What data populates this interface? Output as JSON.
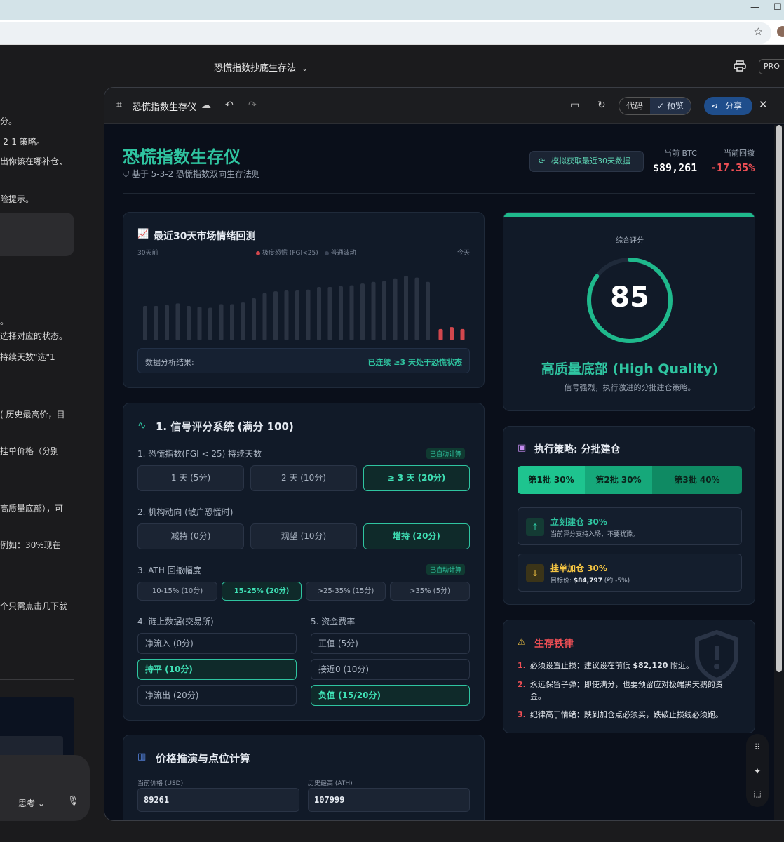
{
  "browser": {
    "minimize": "—",
    "maximize": "☐",
    "bookmark_icon": "star-icon"
  },
  "app": {
    "doc_title": "恐慌指数抄底生存法",
    "pro": "PRO"
  },
  "chat": {
    "lines": [
      "分。",
      "-2-1 策略。",
      "出你该在哪补仓、",
      "险提示。",
      "。",
      "选择对应的状态。",
      "持续天数\"选\"1",
      "( 历史最高价，目",
      "挂单价格（分别",
      "高质量底部），可",
      "例如：30%现在",
      "个只需点击几下就"
    ],
    "think_label": "思考"
  },
  "panel": {
    "title": "恐慌指数生存仪",
    "code_label": "代码",
    "preview_label": "预览",
    "share_label": "分享"
  },
  "header": {
    "title": "恐慌指数生存仪",
    "subtitle": "基于 5-3-2 恐慌指数双向生存法则",
    "sim_button": "模拟获取最近30天数据",
    "btc_label": "当前 BTC",
    "btc_value": "$89,261",
    "drawdown_label": "当前回撤",
    "drawdown_value": "-17.35%"
  },
  "backtest": {
    "title": "最近30天市场情绪回测",
    "left_label": "30天前",
    "right_label": "今天",
    "legend_fear": "极度恐慌 (FGI<25)",
    "legend_normal": "普通波动",
    "analysis_label": "数据分析结果:",
    "analysis_value": "已连续 ≥3 天处于恐慌状态",
    "chart_data": {
      "type": "bar",
      "normal_values": [
        40,
        40,
        41,
        43,
        40,
        39,
        38,
        42,
        42,
        44,
        49,
        55,
        57,
        58,
        58,
        59,
        62,
        62,
        63,
        64,
        66,
        68,
        69,
        72,
        75,
        73,
        68
      ],
      "fear_values": [
        6,
        7,
        6
      ],
      "colors": {
        "normal": "#2a3342",
        "fear": "#d2474d"
      }
    }
  },
  "scoring": {
    "title": "1. 信号评分系统 (满分 100)",
    "auto_tag": "已自动计算",
    "q1": {
      "label": "1. 恐慌指数(FGI < 25) 持续天数",
      "options": [
        "1 天 (5分)",
        "2 天 (10分)",
        "≥ 3 天 (20分)"
      ]
    },
    "q2": {
      "label": "2. 机构动向 (散户恐慌时)",
      "options": [
        "减持 (0分)",
        "观望 (10分)",
        "增持 (20分)"
      ]
    },
    "q3": {
      "label": "3. ATH 回撤幅度",
      "options": [
        "10-15% (10分)",
        "15-25% (20分)",
        ">25-35% (15分)",
        ">35% (5分)"
      ]
    },
    "q4": {
      "label": "4. 链上数据(交易所)",
      "options": [
        "净流入 (0分)",
        "持平 (10分)",
        "净流出 (20分)"
      ]
    },
    "q5": {
      "label": "5. 资金费率",
      "options": [
        "正值 (5分)",
        "接近0 (10分)",
        "负值 (15/20分)"
      ]
    }
  },
  "price": {
    "title": "价格推演与点位计算",
    "current_label": "当前价格 (USD)",
    "current_value": "89261",
    "ath_label": "历史最高 (ATH)",
    "ath_value": "107999"
  },
  "score": {
    "label": "综合评分",
    "value": "85",
    "value_fraction": 0.85,
    "grade": "高质量底部 (High Quality)",
    "desc": "信号强烈，执行激进的分批建仓策略。"
  },
  "strategy": {
    "title": "执行策略: 分批建仓",
    "batches": [
      "第1批 30%",
      "第2批 30%",
      "第3批 40%"
    ],
    "step1_title": "立刻建仓 30%",
    "step1_desc": "当前评分支持入场，不要犹豫。",
    "step2_title": "挂单加仓 30%",
    "step2_desc_prefix": "目标价: ",
    "step2_price": "$84,797",
    "step2_suffix": " (约 -5%)"
  },
  "rules": {
    "title": "生存铁律",
    "items": [
      {
        "n": "1.",
        "text_a": "必须设置止损：建议设在前低 ",
        "bold": "$82,120",
        "text_b": " 附近。"
      },
      {
        "n": "2.",
        "text_a": "永远保留子弹：即使满分，也要预留应对极端黑天鹅的资金。",
        "bold": "",
        "text_b": ""
      },
      {
        "n": "3.",
        "text_a": "纪律高于情绪：跌到加仓点必须买，跌破止损线必须跑。",
        "bold": "",
        "text_b": ""
      }
    ]
  }
}
